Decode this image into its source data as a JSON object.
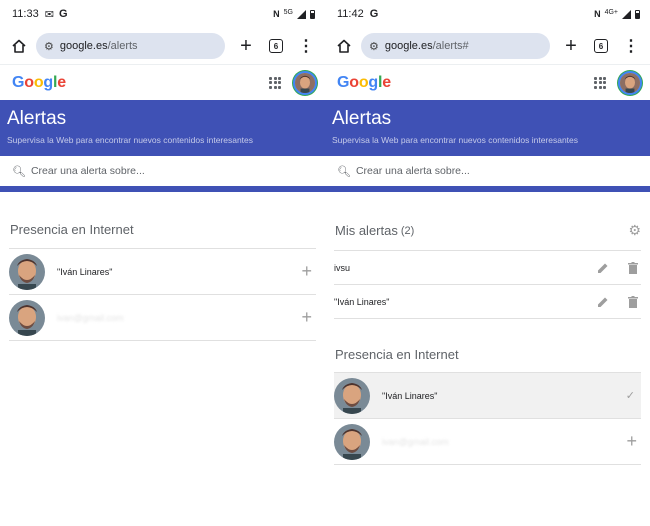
{
  "left": {
    "status": {
      "time": "11:33",
      "net": "5G"
    },
    "url": {
      "host": "google.es",
      "path": "/alerts"
    },
    "tab_count": "6",
    "title": "Alertas",
    "subtitle": "Supervisa la Web para encontrar nuevos contenidos interesantes",
    "search_placeholder": "Crear una alerta sobre...",
    "presence_title": "Presencia en Internet",
    "presence": [
      {
        "label": "\"Iván Linares\"",
        "action": "add"
      },
      {
        "label": "ivan@gmail.com",
        "action": "add",
        "blurred": true
      }
    ]
  },
  "right": {
    "status": {
      "time": "11:42",
      "net": "4G+"
    },
    "url": {
      "host": "google.es",
      "path": "/alerts#"
    },
    "tab_count": "6",
    "title": "Alertas",
    "subtitle": "Supervisa la Web para encontrar nuevos contenidos interesantes",
    "search_placeholder": "Crear una alerta sobre...",
    "my_alerts_title": "Mis alertas",
    "my_alerts_count": "(2)",
    "alerts": [
      {
        "query": "ivsu"
      },
      {
        "query": "\"Iván Linares\""
      }
    ],
    "presence_title": "Presencia en Internet",
    "presence": [
      {
        "label": "\"Iván Linares\"",
        "action": "added"
      },
      {
        "label": "ivan@gmail.com",
        "action": "add",
        "blurred": true
      }
    ]
  },
  "colors": {
    "banner": "#3f51b5",
    "urlbar": "#dde3ef"
  }
}
